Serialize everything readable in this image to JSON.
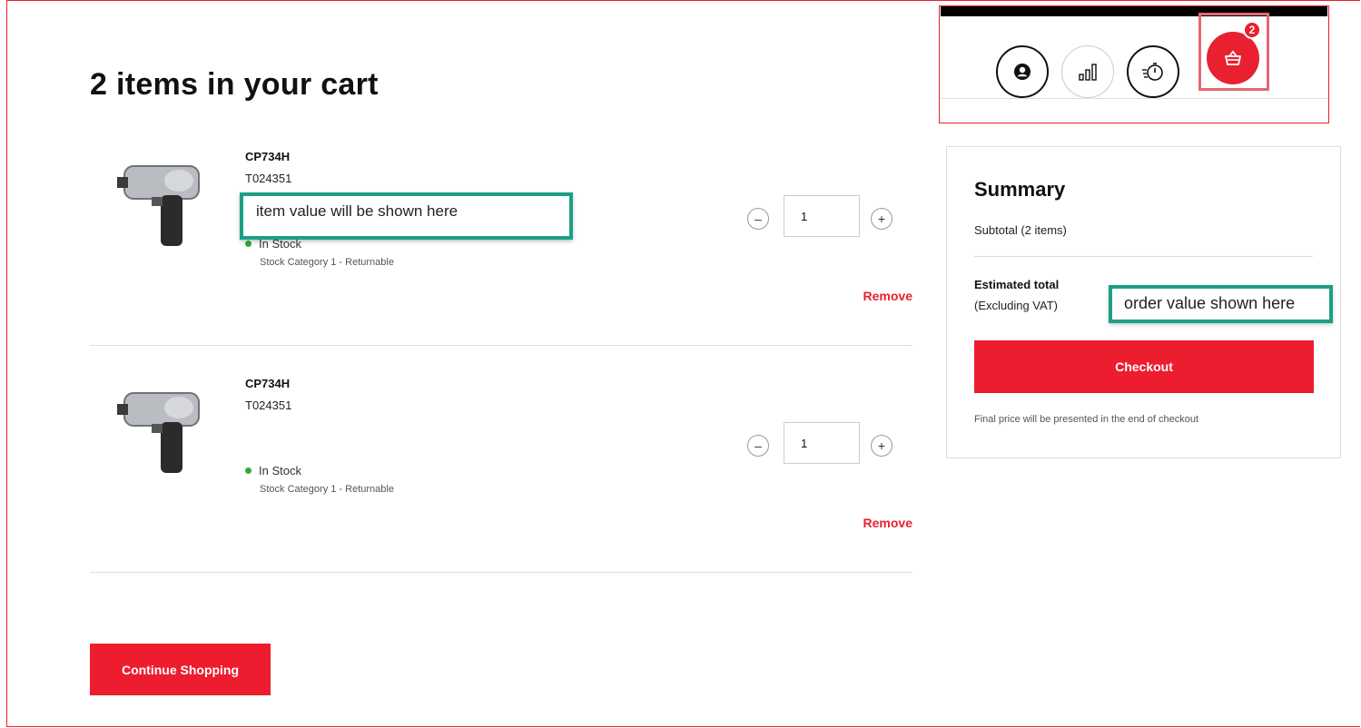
{
  "cart": {
    "title": "2 items in your cart",
    "items": [
      {
        "name": "CP734H",
        "sku": "T024351",
        "stock": "In Stock",
        "stock_category": "Stock Category 1 - Returnable",
        "quantity": "1",
        "remove_label": "Remove"
      },
      {
        "name": "CP734H",
        "sku": "T024351",
        "stock": "In Stock",
        "stock_category": "Stock Category 1 - Returnable",
        "quantity": "1",
        "remove_label": "Remove"
      }
    ],
    "continue_label": "Continue Shopping"
  },
  "header": {
    "cart_count": "2",
    "icons": [
      "account-icon",
      "compare-icon",
      "quick-order-icon",
      "basket-icon"
    ]
  },
  "summary": {
    "title": "Summary",
    "subtotal_label": "Subtotal (2 items)",
    "estimated_total_label": "Estimated total",
    "excluding_vat_label": "(Excluding VAT)",
    "checkout_label": "Checkout",
    "note": "Final price will be presented in the end of checkout"
  },
  "annotations": {
    "item_value": "item value will be shown here",
    "order_value": "order value shown here"
  },
  "colors": {
    "accent": "#ed1c2e",
    "annotation_border": "#1aa085",
    "in_stock": "#2eaa3a"
  }
}
